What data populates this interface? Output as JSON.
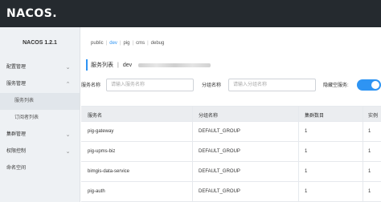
{
  "brand": {
    "logo_text": "NACOS."
  },
  "sidebar": {
    "title": "NACOS 1.2.1",
    "items": [
      {
        "label": "配置管理",
        "expandable": true
      },
      {
        "label": "服务管理",
        "expandable": true
      },
      {
        "label": "服务列表",
        "sub": true,
        "active": true
      },
      {
        "label": "订阅者列表",
        "sub": true
      },
      {
        "label": "集群管理",
        "expandable": true
      },
      {
        "label": "权限控制",
        "expandable": true
      },
      {
        "label": "命名空间"
      }
    ]
  },
  "namespaces": {
    "items": [
      "public",
      "dev",
      "pig",
      "cms",
      "debug"
    ],
    "active": "dev"
  },
  "page": {
    "title": "服务列表",
    "separator": "|",
    "namespace": "dev"
  },
  "filters": {
    "service_name_label": "服务名称",
    "service_name_placeholder": "请输入服务名称",
    "group_name_label": "分组名称",
    "group_name_placeholder": "请输入分组名称",
    "hide_empty_label": "隐藏空服务:",
    "hide_empty_on": true
  },
  "table": {
    "columns": [
      "服务名",
      "分组名称",
      "集群数目",
      "实例"
    ],
    "rows": [
      [
        "pig-gateway",
        "DEFAULT_GROUP",
        "1",
        "1"
      ],
      [
        "pig-upms-biz",
        "DEFAULT_GROUP",
        "1",
        "1"
      ],
      [
        "bimgis-data-service",
        "DEFAULT_GROUP",
        "1",
        "1"
      ],
      [
        "pig-auth",
        "DEFAULT_GROUP",
        "1",
        "1"
      ]
    ]
  },
  "colors": {
    "accent": "#2e94f3",
    "topbar": "#252a2f",
    "sidebar": "#eef1f4"
  }
}
